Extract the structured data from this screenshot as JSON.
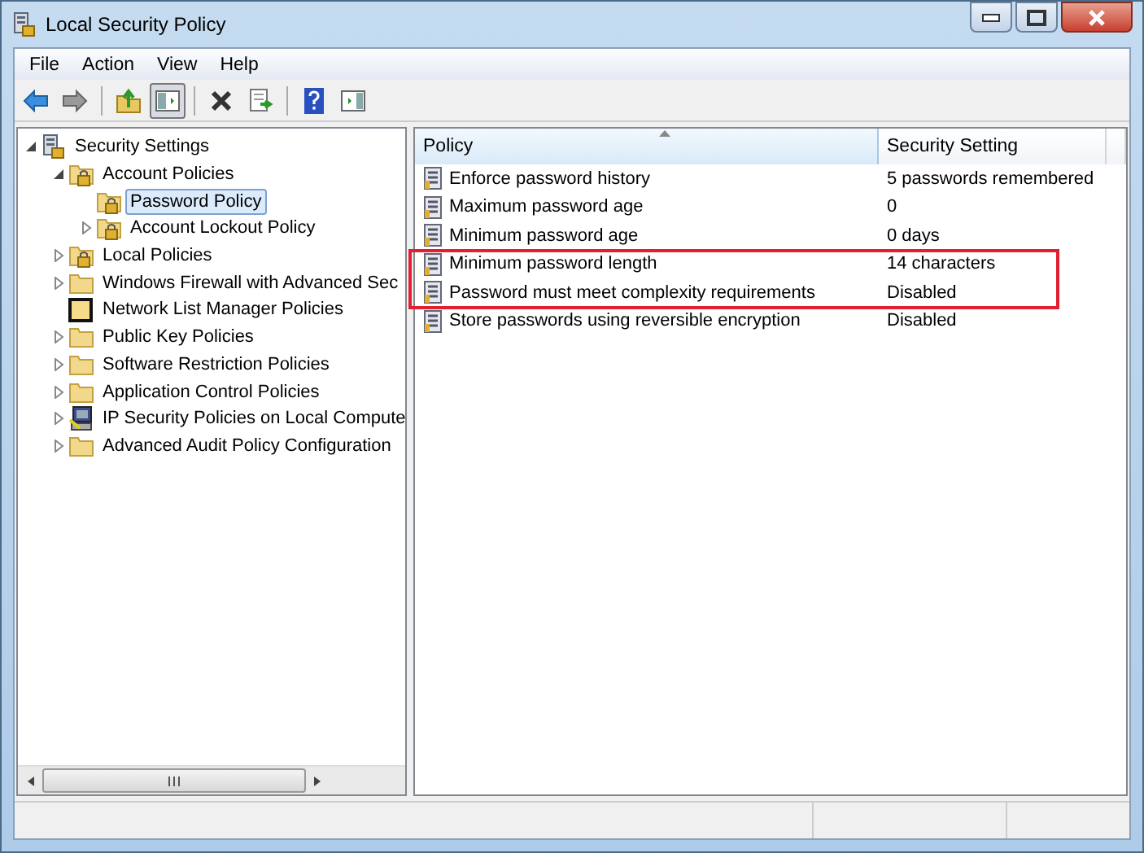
{
  "window": {
    "title": "Local Security Policy"
  },
  "menu": [
    "File",
    "Action",
    "View",
    "Help"
  ],
  "tree": [
    {
      "label": "Security Settings",
      "kind": "policy",
      "selected": false,
      "expanded": true,
      "children": [
        {
          "label": "Account Policies",
          "kind": "lockfolder",
          "selected": false,
          "expanded": true,
          "children": [
            {
              "label": "Password Policy",
              "kind": "lockfolder",
              "selected": true
            },
            {
              "label": "Account Lockout Policy",
              "kind": "lockfolder",
              "selected": false,
              "expanded": false
            }
          ]
        },
        {
          "label": "Local Policies",
          "kind": "lockfolder",
          "selected": false,
          "expanded": false
        },
        {
          "label": "Windows Firewall with Advanced Sec",
          "kind": "folder",
          "selected": false,
          "expanded": false
        },
        {
          "label": "Network List Manager Policies",
          "kind": "blackfolder",
          "selected": false
        },
        {
          "label": "Public Key Policies",
          "kind": "folder",
          "selected": false,
          "expanded": false
        },
        {
          "label": "Software Restriction Policies",
          "kind": "folder",
          "selected": false,
          "expanded": false
        },
        {
          "label": "Application Control Policies",
          "kind": "folder",
          "selected": false,
          "expanded": false
        },
        {
          "label": "IP Security Policies on Local Compute",
          "kind": "computer",
          "selected": false,
          "expanded": false
        },
        {
          "label": "Advanced Audit Policy Configuration",
          "kind": "folder",
          "selected": false,
          "expanded": false
        }
      ]
    }
  ],
  "table": {
    "columns": [
      "Policy",
      "Security Setting"
    ],
    "rows": [
      {
        "policy": "Enforce password history",
        "setting": "5 passwords remembered",
        "highlighted": false
      },
      {
        "policy": "Maximum password age",
        "setting": "0",
        "highlighted": false
      },
      {
        "policy": "Minimum password age",
        "setting": "0 days",
        "highlighted": false
      },
      {
        "policy": "Minimum password length",
        "setting": "14 characters",
        "highlighted": true
      },
      {
        "policy": "Password must meet complexity requirements",
        "setting": "Disabled",
        "highlighted": true
      },
      {
        "policy": "Store passwords using reversible encryption",
        "setting": "Disabled",
        "highlighted": false
      }
    ]
  }
}
